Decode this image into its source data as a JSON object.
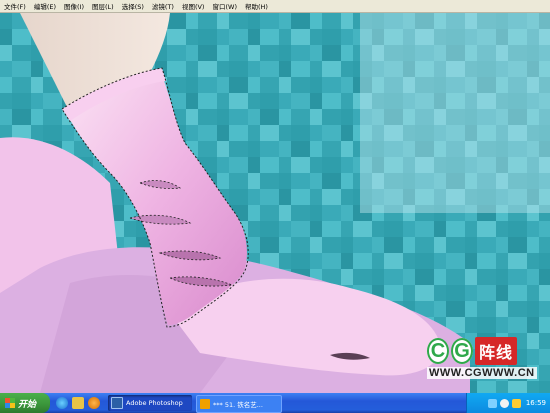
{
  "menu": {
    "items": [
      "文件(F)",
      "编辑(E)",
      "图像(I)",
      "图层(L)",
      "选择(S)",
      "滤镜(T)",
      "视图(V)",
      "窗口(W)",
      "帮助(H)"
    ]
  },
  "watermark": {
    "logo_letters": [
      "C",
      "G"
    ],
    "logo_cn": "阵线",
    "url": "WWW.CGWWW.CN"
  },
  "taskbar": {
    "start_label": "开始",
    "quicklaunch_icons": [
      "ie-icon",
      "show-desktop-icon",
      "media-player-icon"
    ],
    "tasks": [
      {
        "label": "Adobe Photoshop",
        "icon": "photoshop-icon",
        "active": true
      },
      {
        "label": "*** 51. 铁名艺...",
        "icon": "forum-icon",
        "active": false
      }
    ],
    "clock": "16:59"
  },
  "colors": {
    "canvas_teal": "#39aab7",
    "glove_pink": "#f0b6e6",
    "selection_ants": "#222222",
    "taskbar_blue": "#245edb",
    "start_green": "#3a943a"
  }
}
